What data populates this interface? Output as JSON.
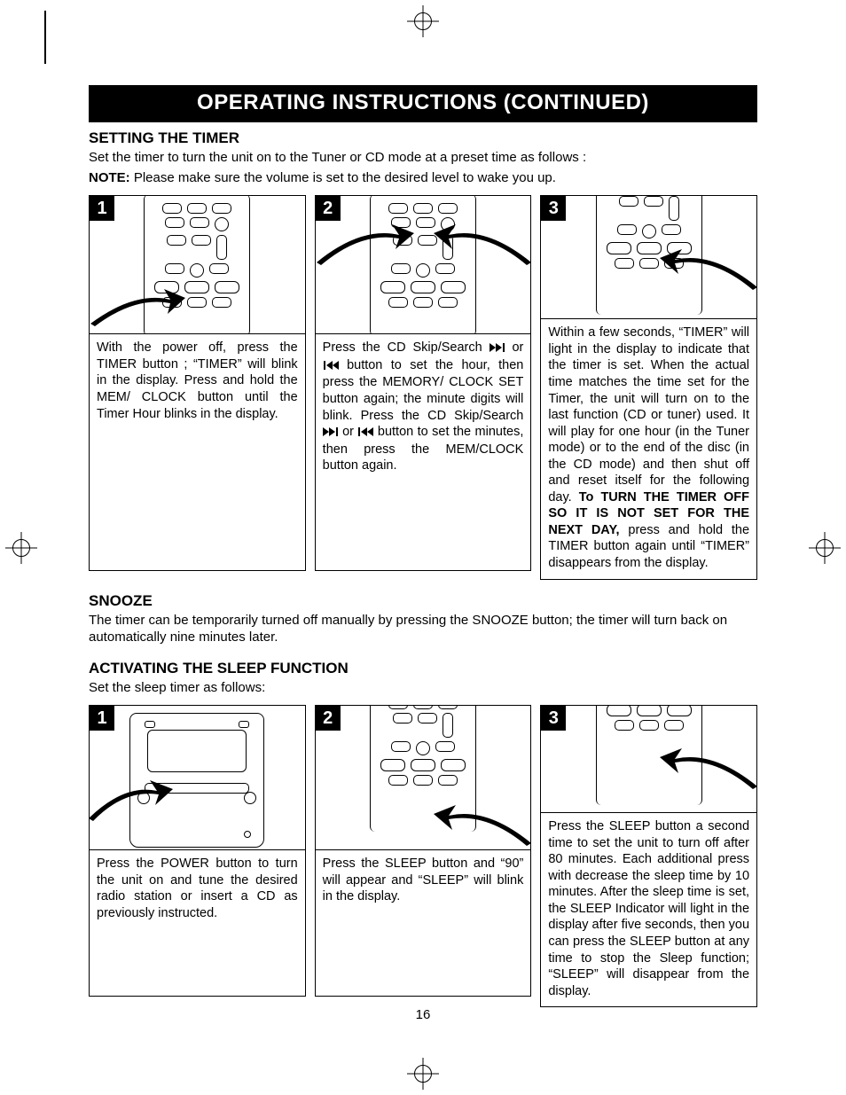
{
  "banner_title": "OPERATING INSTRUCTIONS (CONTINUED)",
  "timer": {
    "heading": "SETTING THE TIMER",
    "intro": "Set the timer to turn the unit on to the Tuner or CD mode at a preset time as follows :",
    "note_label": "NOTE:",
    "note_text": " Please make sure the volume is set to the desired level to wake you up.",
    "steps": [
      {
        "badge": "1",
        "text": "With the power off, press the TIMER button ; “TIMER” will blink in the display. Press and hold the MEM/ CLOCK button until the Timer Hour blinks in the display."
      },
      {
        "badge": "2",
        "text_pre": "Press the CD Skip/Search ",
        "text_mid1": " or ",
        "text_mid2": " button to set the hour, then press the MEMORY/ CLOCK SET button again; the minute digits will blink. Press the CD Skip/Search ",
        "text_mid3": " or ",
        "text_post": " button to set the minutes, then press the MEM/CLOCK button again."
      },
      {
        "badge": "3",
        "text_a": "Within a few seconds, “TIMER” will light in the display to indicate that the timer is set. When the actual time matches the time set for the Timer, the unit will turn on to the last function (CD or tuner) used. It will play for one hour (in the Tuner mode) or to the end of the disc (in the CD mode) and then shut off and reset itself for the following day. ",
        "text_bold": "To TURN THE TIMER OFF SO IT IS NOT SET FOR THE NEXT DAY,",
        "text_b": " press and hold the TIMER button again until “TIMER” disappears from the display."
      }
    ]
  },
  "snooze": {
    "heading": "SNOOZE",
    "text": "The timer can be temporarily turned off manually by pressing the SNOOZE button; the timer will turn back on automatically nine minutes later."
  },
  "sleep": {
    "heading": "ACTIVATING THE SLEEP FUNCTION",
    "intro": "Set the sleep timer as follows:",
    "steps": [
      {
        "badge": "1",
        "text": "Press the POWER button to turn the unit on and tune the desired radio station or insert a CD as previously instructed."
      },
      {
        "badge": "2",
        "text": "Press the SLEEP button and “90” will appear and “SLEEP” will blink in the display."
      },
      {
        "badge": "3",
        "text": "Press the SLEEP button a second time to set the unit to turn off after 80 minutes. Each additional press with decrease the sleep time by 10 minutes. After the sleep time is set, the SLEEP Indicator will light in the display after five seconds, then you can press the SLEEP button at any time to stop the Sleep function; “SLEEP” will disappear from the display."
      }
    ]
  },
  "page_number": "16",
  "icons": {
    "skip_fwd": "skip-forward-icon",
    "skip_back": "skip-back-icon"
  }
}
